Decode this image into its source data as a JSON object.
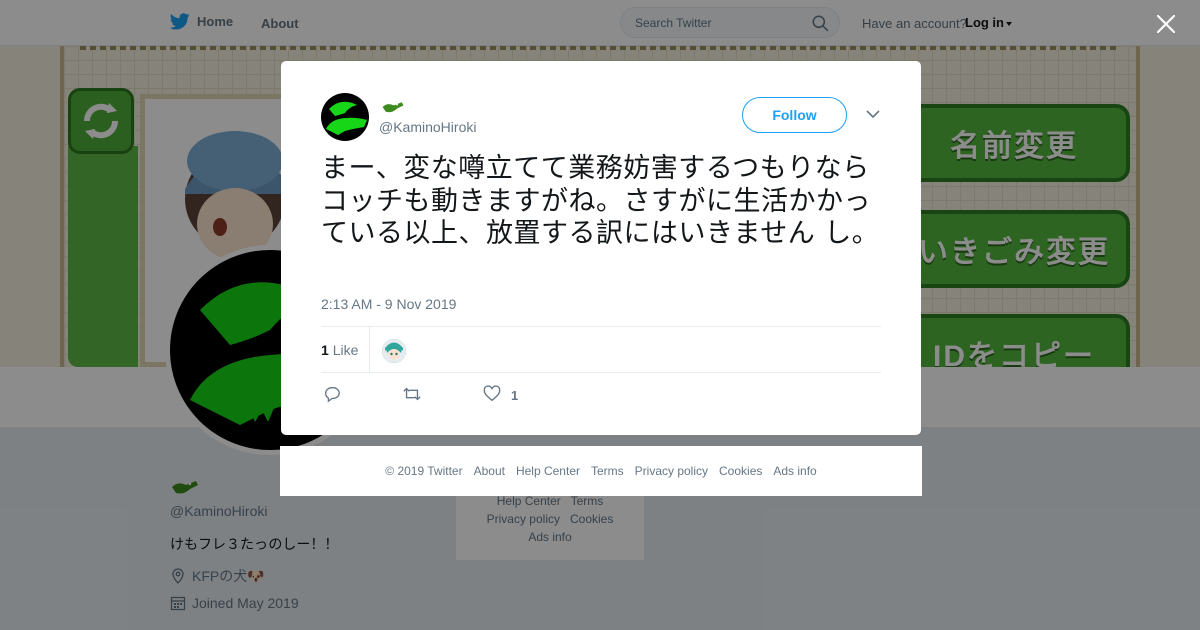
{
  "nav": {
    "home_label": "Home",
    "about_label": "About",
    "search_placeholder": "Search Twitter",
    "account_prompt": "Have an account?",
    "login_label": "Log in"
  },
  "banner": {
    "buttons": [
      "名前変更",
      "いきごみ変更",
      "IDをコピー"
    ]
  },
  "profile": {
    "handle": "@KaminoHiroki",
    "bio": "けもフレ３たっのしー！！",
    "location": "KFPの犬🐶",
    "joined": "Joined May 2019"
  },
  "side_footer": {
    "rows": [
      [
        "Help Center",
        "Terms"
      ],
      [
        "Privacy policy",
        "Cookies"
      ],
      [
        "Ads info"
      ]
    ]
  },
  "tweet": {
    "handle": "@KaminoHiroki",
    "follow_label": "Follow",
    "text": "まー、変な噂立てて業務妨害するつもりならコッチも動きますがね。さすがに生活かかっている以上、放置する訳にはいきません し。",
    "timestamp": "2:13 AM - 9 Nov 2019",
    "like_count": "1",
    "like_word": "Like",
    "action_like_count": "1"
  },
  "modal_footer": {
    "links": [
      "© 2019 Twitter",
      "About",
      "Help Center",
      "Terms",
      "Privacy policy",
      "Cookies",
      "Ads info"
    ]
  },
  "colors": {
    "accent": "#1da1f2",
    "brand_green": "#00d100",
    "muted": "#657786"
  },
  "icons": [
    "twitter-bird-icon",
    "search-icon",
    "close-icon",
    "chevron-down-icon",
    "reply-icon",
    "retweet-icon",
    "heart-icon",
    "location-icon",
    "calendar-icon"
  ]
}
